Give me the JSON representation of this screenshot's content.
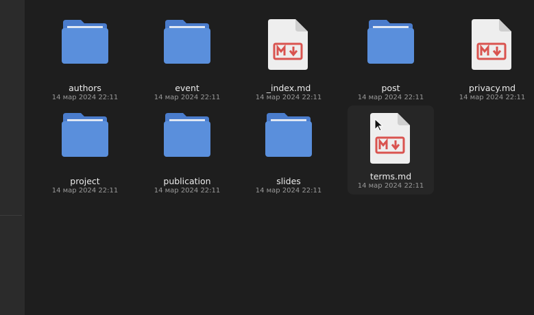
{
  "files": [
    {
      "name": "authors",
      "date": "14 мар 2024 22:11",
      "type": "folder"
    },
    {
      "name": "event",
      "date": "14 мар 2024 22:11",
      "type": "folder"
    },
    {
      "name": "_index.md",
      "date": "14 мар 2024 22:11",
      "type": "markdown"
    },
    {
      "name": "post",
      "date": "14 мар 2024 22:11",
      "type": "folder"
    },
    {
      "name": "privacy.md",
      "date": "14 мар 2024 22:11",
      "type": "markdown"
    },
    {
      "name": "project",
      "date": "14 мар 2024 22:11",
      "type": "folder"
    },
    {
      "name": "publication",
      "date": "14 мар 2024 22:11",
      "type": "folder"
    },
    {
      "name": "slides",
      "date": "14 мар 2024 22:11",
      "type": "folder"
    },
    {
      "name": "terms.md",
      "date": "14 мар 2024 22:11",
      "type": "markdown"
    }
  ],
  "icons": {
    "folder": "folder-icon",
    "markdown": "markdown-file-icon"
  },
  "colors": {
    "background": "#1e1e1e",
    "folder_body": "#5a8fdc",
    "folder_tab": "#4a7ccc",
    "markdown_badge": "#d9534f",
    "file_page": "#eeeeee"
  }
}
